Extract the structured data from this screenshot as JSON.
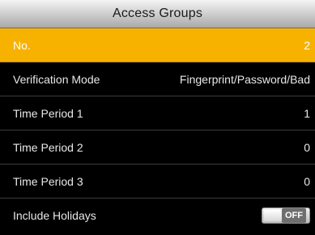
{
  "title": "Access Groups",
  "rows": [
    {
      "label": "No.",
      "value": "2",
      "selected": true
    },
    {
      "label": "Verification Mode",
      "value": "Fingerprint/Password/Bad"
    },
    {
      "label": "Time Period 1",
      "value": "1"
    },
    {
      "label": "Time Period 2",
      "value": "0"
    },
    {
      "label": "Time Period 3",
      "value": "0"
    },
    {
      "label": "Include Holidays",
      "toggle": "OFF"
    }
  ],
  "colors": {
    "selected_background": "#f7b200",
    "list_background": "#000000"
  }
}
